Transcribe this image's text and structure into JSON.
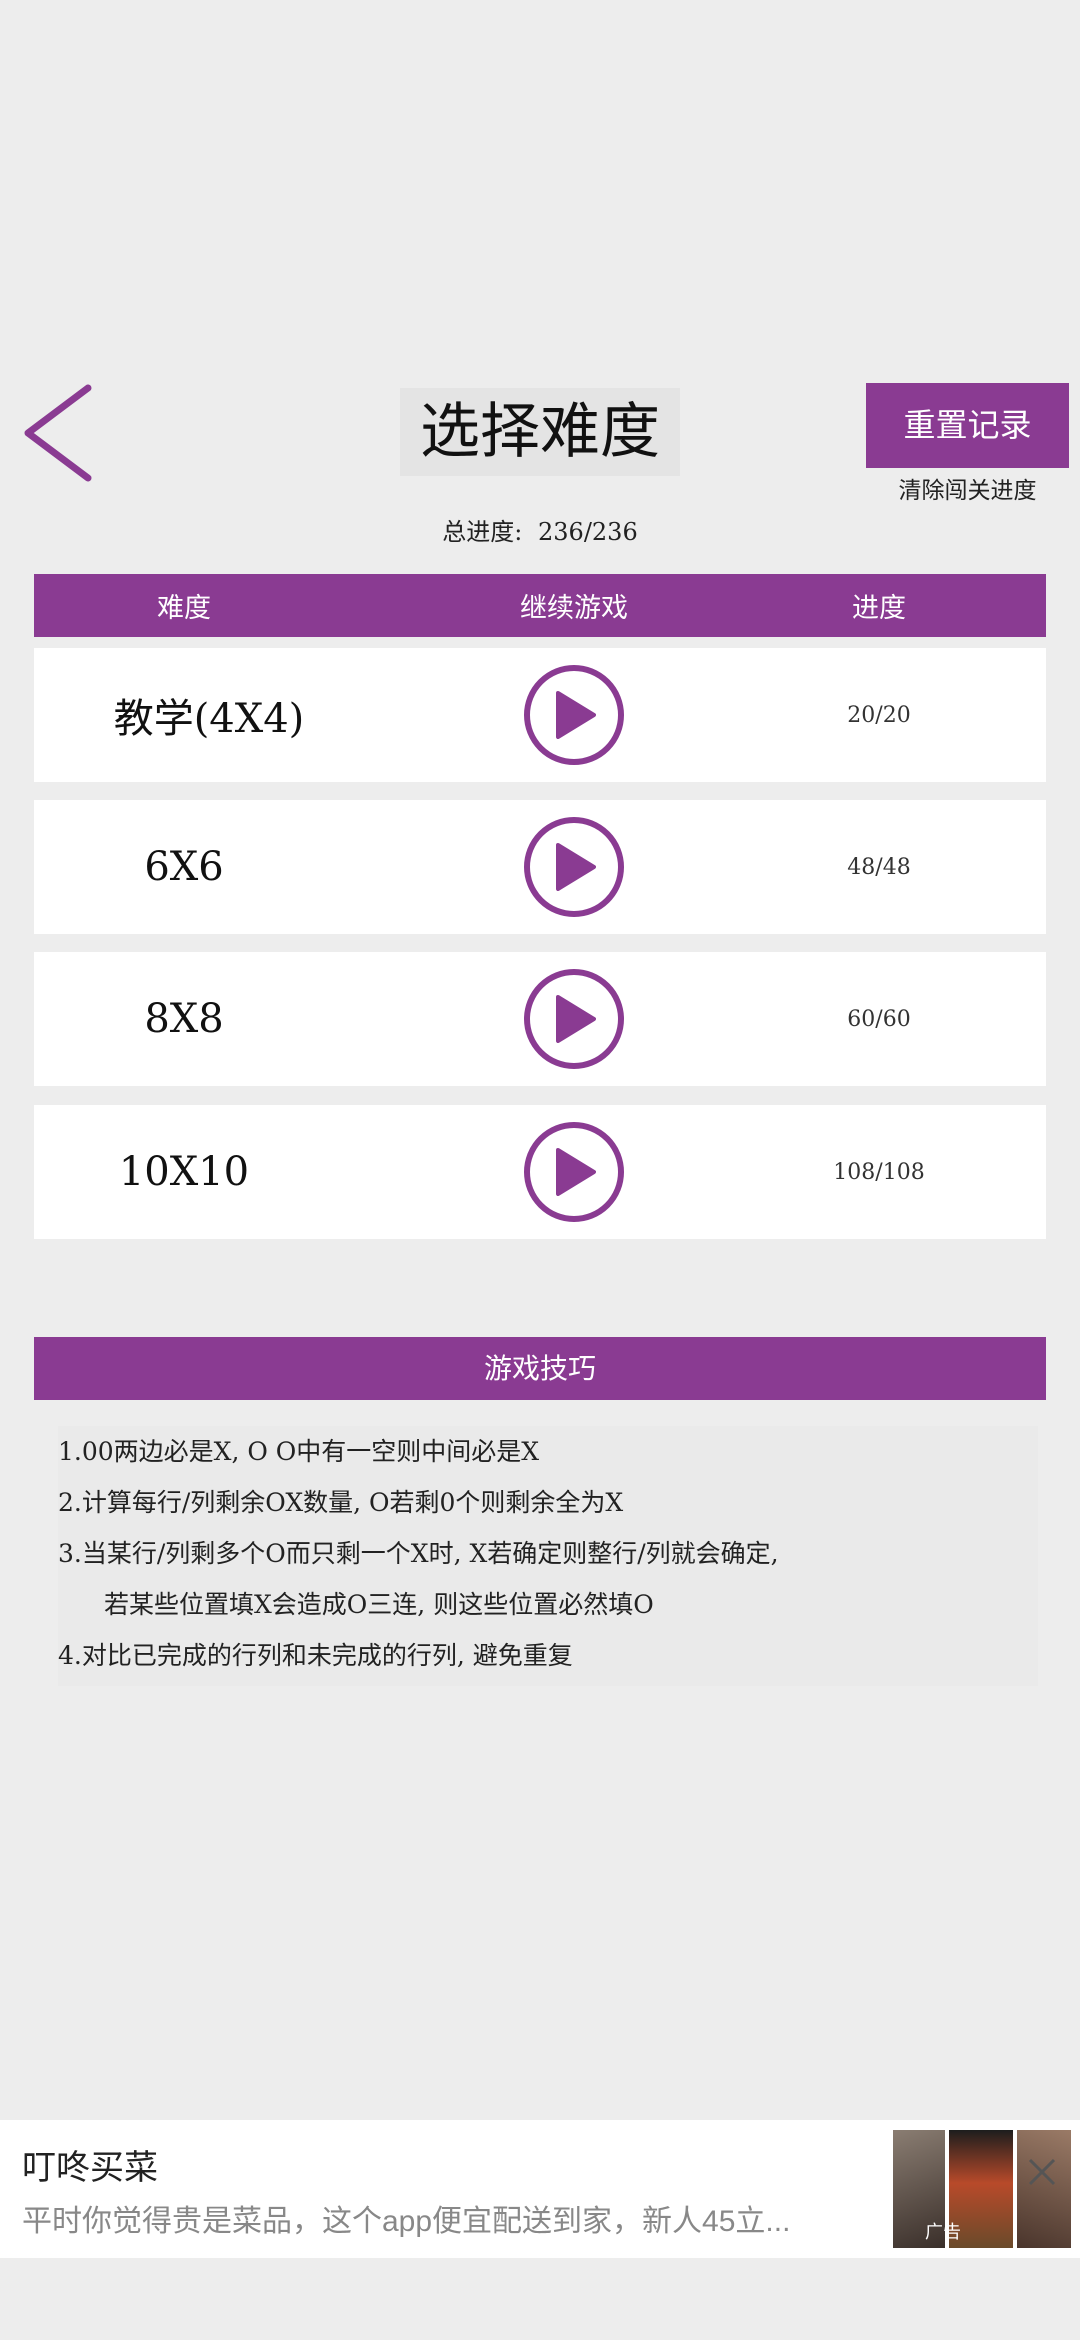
{
  "header": {
    "title": "选择难度",
    "reset_button_label": "重置记录",
    "reset_button_sublabel": "清除闯关进度",
    "total_progress_label": "总进度:",
    "total_progress_value": "236/236"
  },
  "table": {
    "columns": [
      "难度",
      "继续游戏",
      "进度"
    ],
    "rows": [
      {
        "difficulty": "教学(4X4)",
        "progress": "20/20"
      },
      {
        "difficulty": "6X6",
        "progress": "48/48"
      },
      {
        "difficulty": "8X8",
        "progress": "60/60"
      },
      {
        "difficulty": "10X10",
        "progress": "108/108"
      }
    ]
  },
  "tips": {
    "title": "游戏技巧",
    "items": [
      "1.00两边必是X, O O中有一空则中间必是X",
      "2.计算每行/列剩余OX数量, O若剩0个则剩余全为X",
      "3.当某行/列剩多个O而只剩一个X时, X若确定则整行/列就会确定,",
      "若某些位置填X会造成O三连, 则这些位置必然填O",
      "4.对比已完成的行列和未完成的行列, 避免重复"
    ]
  },
  "ad": {
    "title": "叮咚买菜",
    "description": "平时你觉得贵是菜品，这个app便宜配送到家，新人45立...",
    "label": "广告"
  },
  "colors": {
    "accent": "#8a3b92",
    "background": "#ededed",
    "row_background": "#ffffff"
  },
  "icons": {
    "back": "chevron-left-icon",
    "play": "play-icon",
    "close": "close-icon"
  }
}
